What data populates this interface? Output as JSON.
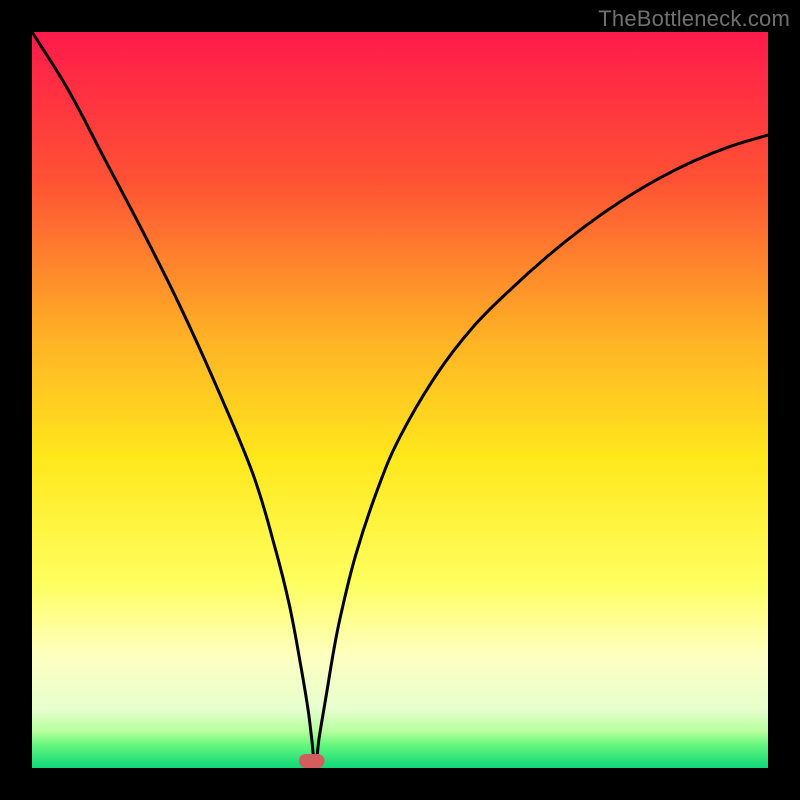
{
  "watermark": "TheBottleneck.com",
  "chart_data": {
    "type": "line",
    "title": "",
    "xlabel": "",
    "ylabel": "",
    "xlim": [
      0,
      100
    ],
    "ylim": [
      0,
      100
    ],
    "x": [
      0,
      5,
      10,
      15,
      20,
      25,
      30,
      33,
      35,
      36.5,
      37.5,
      38,
      38.5,
      39,
      40,
      41,
      42,
      44,
      47,
      50,
      55,
      60,
      65,
      70,
      75,
      80,
      85,
      90,
      95,
      100
    ],
    "values": [
      100,
      92,
      82.5,
      73,
      63,
      52,
      40,
      30,
      22,
      14,
      8,
      4,
      0,
      4,
      10,
      16,
      21,
      29,
      38,
      45,
      53.5,
      60,
      65,
      69.5,
      73.5,
      77,
      80,
      82.5,
      84.5,
      86
    ],
    "marker": {
      "x": 38,
      "width": 3.5,
      "color": "#d35c5c"
    },
    "background_gradient": [
      {
        "pct": 0,
        "color": "#ff1a4b"
      },
      {
        "pct": 20,
        "color": "#ff5134"
      },
      {
        "pct": 42,
        "color": "#ffb325"
      },
      {
        "pct": 58,
        "color": "#ffe81c"
      },
      {
        "pct": 75,
        "color": "#ffff60"
      },
      {
        "pct": 85,
        "color": "#fdffc2"
      },
      {
        "pct": 92,
        "color": "#e7ffce"
      },
      {
        "pct": 95,
        "color": "#b7ff9e"
      },
      {
        "pct": 97,
        "color": "#61f57c"
      },
      {
        "pct": 100,
        "color": "#0fd87a"
      }
    ]
  }
}
